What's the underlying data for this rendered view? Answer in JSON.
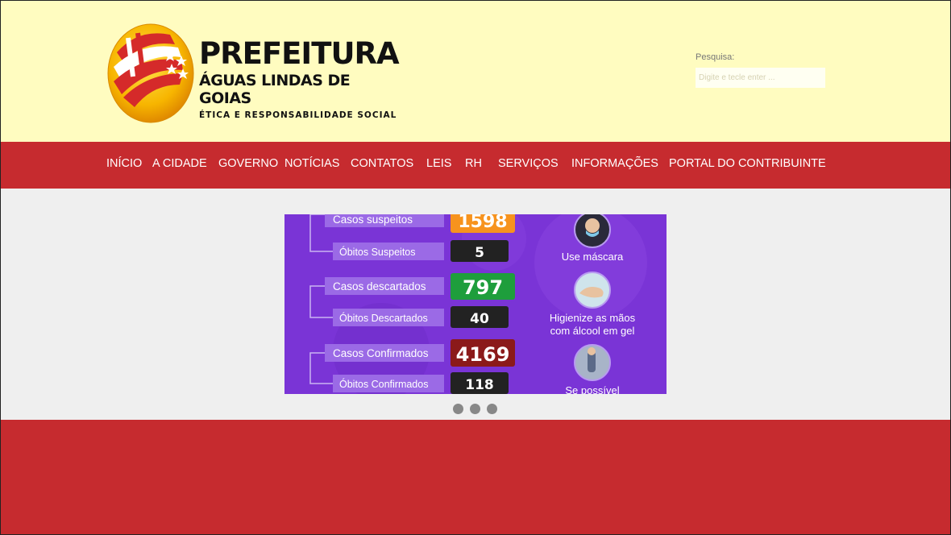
{
  "header": {
    "logo": {
      "line1": "PREFEITURA",
      "line2": "ÁGUAS LINDAS DE GOIAS",
      "line3": "ÉTICA E RESPONSABILIDADE SOCIAL"
    },
    "search": {
      "label": "Pesquisa:",
      "placeholder": "Digite e tecle enter ..."
    }
  },
  "nav": {
    "items": [
      {
        "label": "INÍCIO"
      },
      {
        "label": "A CIDADE"
      },
      {
        "label": "GOVERNO"
      },
      {
        "label": "NOTÍCIAS"
      },
      {
        "label": "CONTATOS"
      },
      {
        "label": "LEIS"
      },
      {
        "label": "RH"
      },
      {
        "label": "SERVIÇOS"
      },
      {
        "label": "INFORMAÇÕES"
      },
      {
        "label": "PORTAL DO CONTRIBUINTE"
      }
    ]
  },
  "slide": {
    "rows": [
      {
        "label": "Casos suspeitos",
        "value": "1598",
        "color": "#f7931e"
      },
      {
        "label": "Óbitos Suspeitos",
        "value": "5",
        "color": "#222222"
      },
      {
        "label": "Casos descartados",
        "value": "797",
        "color": "#1e9e3c"
      },
      {
        "label": "Óbitos Descartados",
        "value": "40",
        "color": "#222222"
      },
      {
        "label": "Casos Confirmados",
        "value": "4169",
        "color": "#8b1a1a"
      },
      {
        "label": "Óbitos Confirmados",
        "value": "118",
        "color": "#222222"
      }
    ],
    "tips": [
      {
        "line1": "Use máscara",
        "line2": ""
      },
      {
        "line1": "Higienize as mãos",
        "line2": "com álcool em gel"
      },
      {
        "line1": "Se possível",
        "line2": ""
      }
    ]
  },
  "colors": {
    "header_bg": "#fffcc0",
    "brand_red": "#c62b2f",
    "slide_purple": "#7a34d6"
  }
}
